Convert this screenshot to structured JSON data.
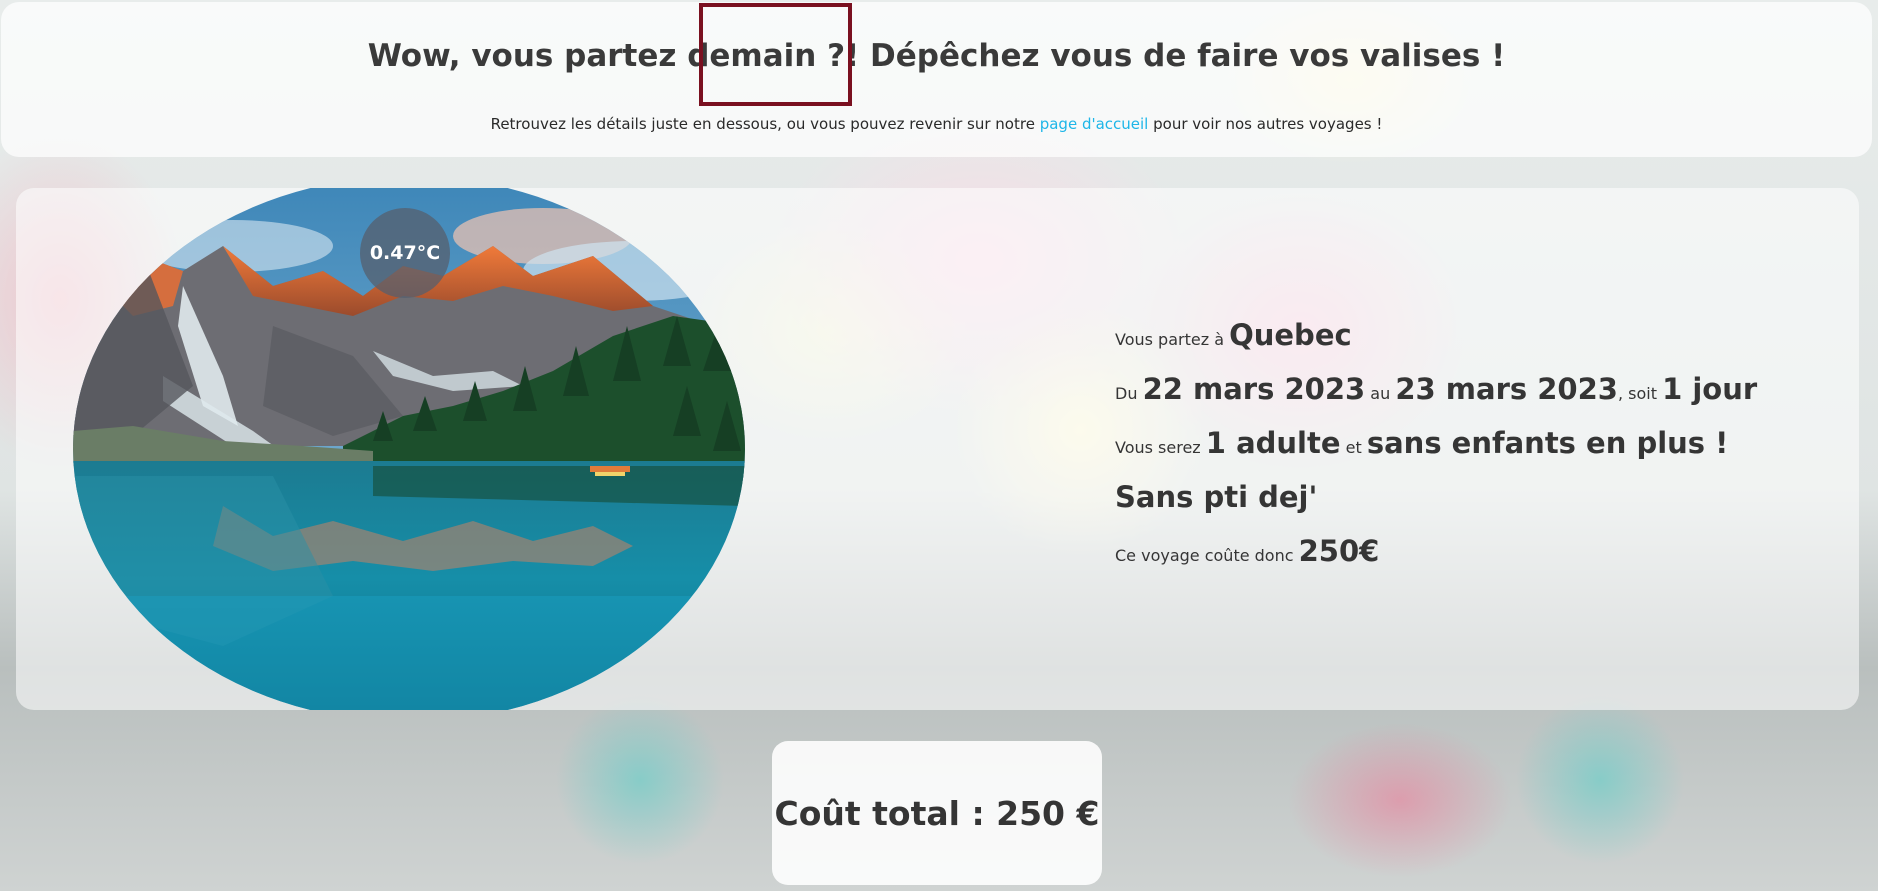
{
  "header": {
    "title": "Wow, vous partez demain ?! Dépêchez vous de faire vos valises !",
    "subtitle_before": "Retrouvez les détails juste en dessous, ou vous pouvez revenir sur notre",
    "home_link": "page d'accueil",
    "subtitle_after": "pour voir nos autres voyages !"
  },
  "weather": {
    "temperature": "0.47°C"
  },
  "trip": {
    "destination_prefix": "Vous partez à",
    "destination": "Quebec",
    "from_prefix": "Du",
    "start_date": "22 mars 2023",
    "to_prefix": "au",
    "end_date": "23 mars 2023",
    "duration_prefix": ", soit",
    "duration": "1 jour",
    "people_prefix": "Vous serez",
    "adults": "1 adulte",
    "and_word": "et",
    "children": "sans enfants en plus !",
    "breakfast": "Sans pti dej'",
    "cost_prefix": "Ce voyage coûte donc",
    "cost": "250€"
  },
  "total": {
    "label": "Coût total : 250 €"
  },
  "colors": {
    "highlight_border": "#7a1020",
    "link": "#1eb6e8",
    "text": "#353535"
  }
}
